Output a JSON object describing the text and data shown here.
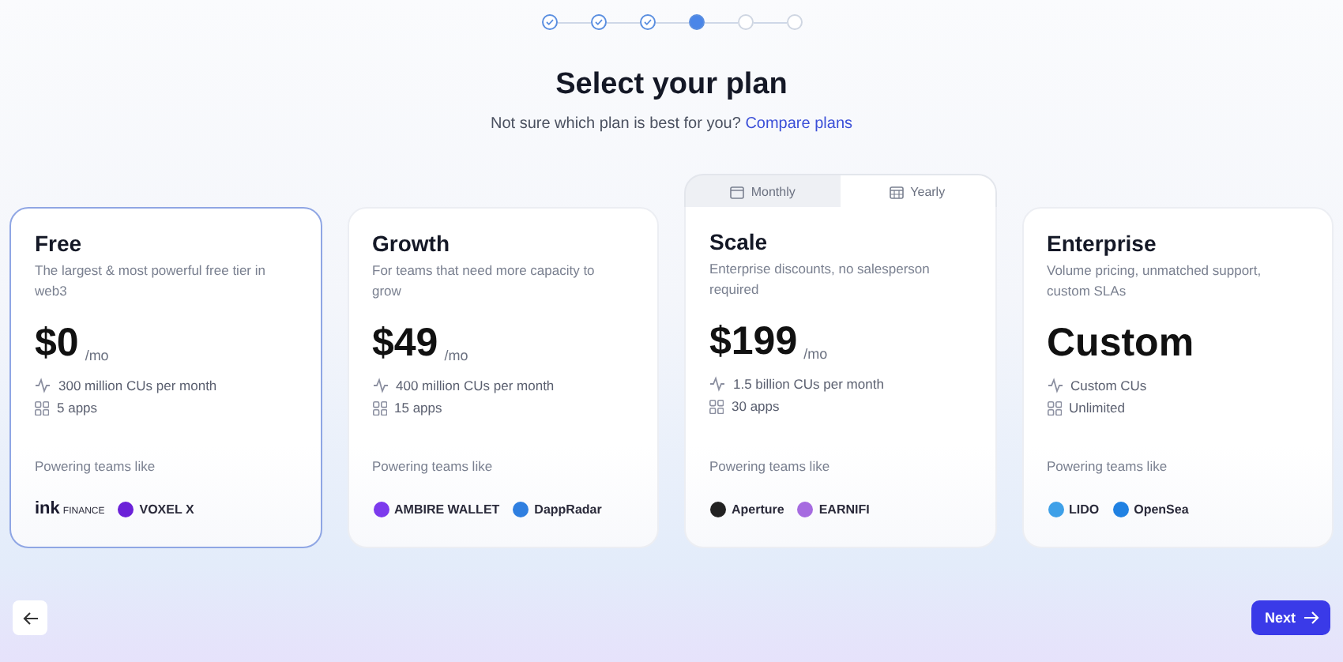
{
  "stepper": [
    {
      "completed": true,
      "current": false
    },
    {
      "completed": true,
      "current": false
    },
    {
      "completed": true,
      "current": false
    },
    {
      "completed": false,
      "current": true
    },
    {
      "completed": false,
      "current": false
    },
    {
      "completed": false,
      "current": false
    }
  ],
  "heading": "Select your plan",
  "subtitle": {
    "text": "Not sure which plan is best for you?",
    "link": "Compare plans"
  },
  "billing_toggle": [
    {
      "label": "Monthly",
      "selected": false
    },
    {
      "label": "Yearly",
      "selected": true
    }
  ],
  "plans": [
    {
      "name": "Free",
      "description": "The largest & most powerful free tier in web3",
      "price": "$0",
      "unit": "/mo",
      "selected": true,
      "has_toggle": false,
      "features": [
        {
          "kind": "usage",
          "text": "300 million CUs per month"
        },
        {
          "kind": "apps",
          "text": "5 apps"
        }
      ],
      "powered_label": "Powering teams like",
      "logos": [
        {
          "kind": "wordmark",
          "text": "ink",
          "sub": "FINANCE",
          "color": "#1a1a2e"
        },
        {
          "kind": "icon",
          "text": "VOXEL X",
          "color": "#6b21d8"
        }
      ]
    },
    {
      "name": "Growth",
      "description": "For teams that need more capacity to grow",
      "price": "$49",
      "unit": "/mo",
      "selected": false,
      "has_toggle": false,
      "features": [
        {
          "kind": "usage",
          "text": "400 million CUs per month"
        },
        {
          "kind": "apps",
          "text": "15 apps"
        }
      ],
      "powered_label": "Powering teams like",
      "logos": [
        {
          "kind": "icon",
          "text": "AMBIRE WALLET",
          "color": "#7c3aed"
        },
        {
          "kind": "icon",
          "text": "DappRadar",
          "color": "#2f7fe0"
        }
      ]
    },
    {
      "name": "Scale",
      "description": "Enterprise discounts, no salesperson required",
      "price": "$199",
      "unit": "/mo",
      "selected": false,
      "has_toggle": true,
      "features": [
        {
          "kind": "usage",
          "text": "1.5 billion CUs per month"
        },
        {
          "kind": "apps",
          "text": "30 apps"
        }
      ],
      "powered_label": "Powering teams like",
      "logos": [
        {
          "kind": "icon",
          "text": "Aperture",
          "color": "#222222"
        },
        {
          "kind": "icon",
          "text": "EARNIFI",
          "color": "#a66be0"
        }
      ]
    },
    {
      "name": "Enterprise",
      "description": "Volume pricing, unmatched support, custom SLAs",
      "price": "Custom",
      "selected": false,
      "has_toggle": false,
      "features": [
        {
          "kind": "usage",
          "text": "Custom CUs"
        },
        {
          "kind": "apps",
          "text": "Unlimited"
        }
      ],
      "powered_label": "Powering teams like",
      "logos": [
        {
          "kind": "icon",
          "text": "LIDO",
          "color": "#3ea0e8"
        },
        {
          "kind": "icon",
          "text": "OpenSea",
          "color": "#2081e2"
        }
      ]
    }
  ],
  "next_button": {
    "label": "Next"
  }
}
